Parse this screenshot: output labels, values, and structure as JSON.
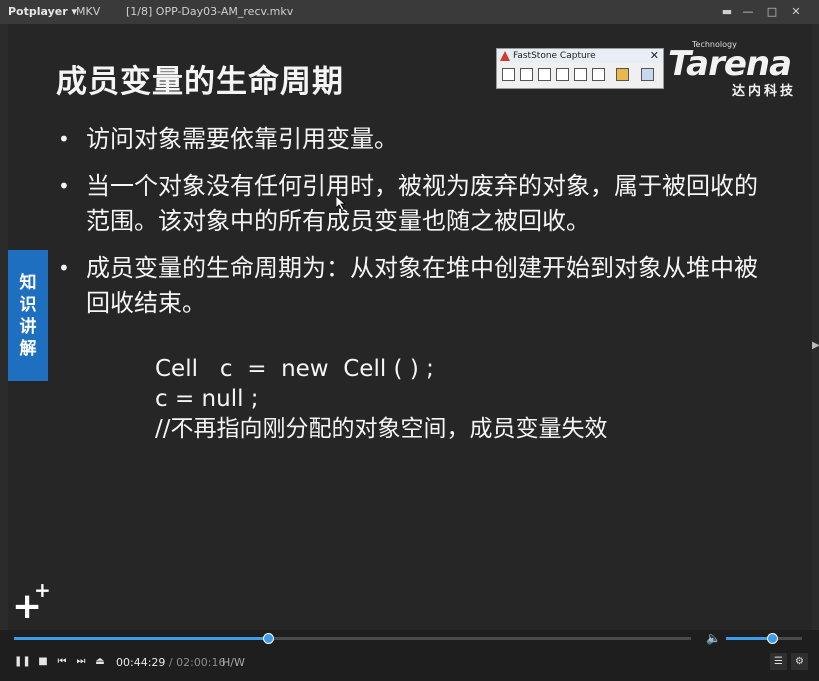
{
  "titlebar": {
    "app_name": "Potplayer",
    "app_caret": "▾",
    "format": "MKV",
    "file_title": "[1/8] OPP-Day03-AM_recv.mkv",
    "buttons": {
      "pin": "▬",
      "minimize": "—",
      "maximize": "□",
      "close": "✕"
    }
  },
  "slide": {
    "title": "成员变量的生命周期",
    "bullet_symbol": "•",
    "bullets": [
      "访问对象需要依靠引用变量。",
      "当一个对象没有任何引用时，被视为废弃的对象，属于被回收的范围。该对象中的所有成员变量也随之被回收。",
      "成员变量的生命周期为：从对象在堆中创建开始到对象从堆中被回收结束。"
    ],
    "code_lines": [
      "Cell   c  =  new  Cell ( ) ;",
      "c = null ;",
      "//不再指向刚分配的对象空间，成员变量失效"
    ],
    "side_tag": [
      "知",
      "识",
      "讲",
      "解"
    ],
    "plus_big": "+",
    "plus_small": "+"
  },
  "logo": {
    "technology": "Technology",
    "name": "Tarena",
    "chinese": "达内科技"
  },
  "faststone": {
    "title": "FastStone Capture",
    "close": "✕"
  },
  "playback": {
    "progress_fraction": 0.375,
    "volume_fraction": 0.6,
    "current_time": "00:44:29",
    "separator": " / ",
    "duration": "02:00:16",
    "codec": "H/W",
    "buttons": {
      "pause": "❚❚",
      "stop": "■",
      "previous": "⏮",
      "next": "⏭",
      "eject": "⏏",
      "playlist": "☰",
      "settings": "⚙",
      "volume": "🔈"
    }
  },
  "colors": {
    "accent": "#3d9be9",
    "tag_blue": "#1e6fc0",
    "slide_bg": "#262626"
  }
}
